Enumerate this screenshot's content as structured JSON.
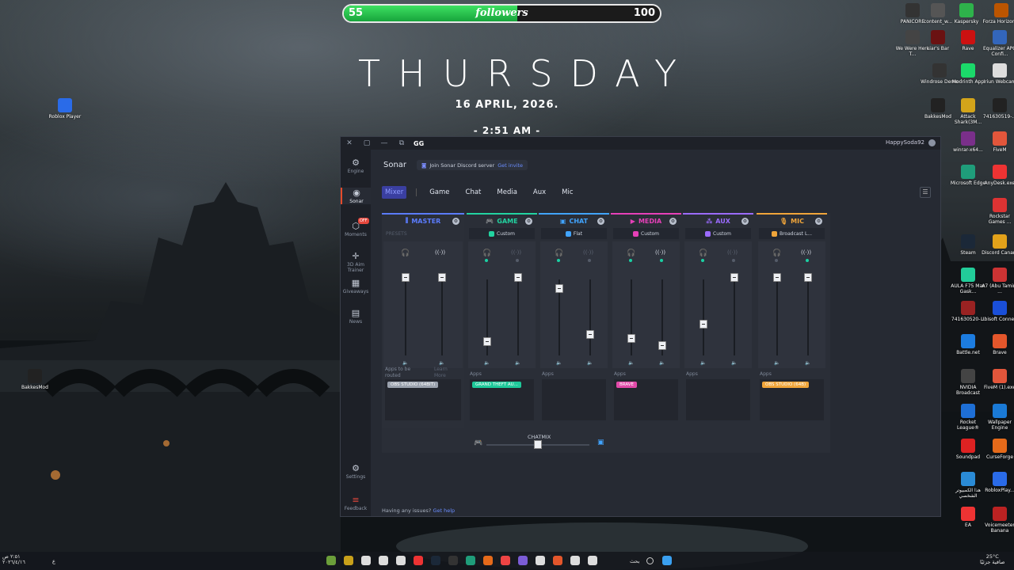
{
  "overlay": {
    "followers_current": "55",
    "followers_label": "followers",
    "followers_goal": "100",
    "followers_progress": 0.55,
    "day": "THURSDAY",
    "date": "16  APRIL, 2026.",
    "time": "- 2:51 AM -"
  },
  "desktop_icons": [
    {
      "label": "Roblox Player",
      "color": "#2a6be8"
    },
    {
      "label": "BakkesMod",
      "color": "#222"
    },
    {
      "label": "PANICORE",
      "color": "#333"
    },
    {
      "label": "content_w...",
      "color": "#555"
    },
    {
      "label": "Kaspersky",
      "color": "#2eb24b"
    },
    {
      "label": "Forza Horizon 5",
      "color": "#b50"
    },
    {
      "label": "We Were Here T...",
      "color": "#444"
    },
    {
      "label": "Liar's Bar",
      "color": "#6a1212"
    },
    {
      "label": "Rave",
      "color": "#c11"
    },
    {
      "label": "Equalizer APO Confi...",
      "color": "#36b"
    },
    {
      "label": "Windrose Demo",
      "color": "#333"
    },
    {
      "label": "Modrinth App",
      "color": "#1bd96a"
    },
    {
      "label": "Iriun Webcam",
      "color": "#ddd"
    },
    {
      "label": "BakkesMod",
      "color": "#222"
    },
    {
      "label": "Attack Shark(3M...",
      "color": "#d3a41a"
    },
    {
      "label": "741630519-...",
      "color": "#222"
    },
    {
      "label": "winrar-x64...",
      "color": "#7a2f8a"
    },
    {
      "label": "FiveM",
      "color": "#e2563b"
    },
    {
      "label": "Microsoft Edge",
      "color": "#1f9d7a"
    },
    {
      "label": "AnyDesk.exe",
      "color": "#e33"
    },
    {
      "label": "Rockstar Games ...",
      "color": "#d33"
    },
    {
      "label": "Steam",
      "color": "#1b2838"
    },
    {
      "label": "Discord Canary",
      "color": "#e3a21a"
    },
    {
      "label": "AULA F75 Max Gask...",
      "color": "#2c9"
    },
    {
      "label": "A7 (Abu Tamim ...",
      "color": "#c33"
    },
    {
      "label": "741630520-...",
      "color": "#922"
    },
    {
      "label": "Ubisoft Connect",
      "color": "#1a4fd8"
    },
    {
      "label": "Battle.net",
      "color": "#1c7ce0"
    },
    {
      "label": "Brave",
      "color": "#e4562b"
    },
    {
      "label": "NVIDIA Broadcast",
      "color": "#444"
    },
    {
      "label": "FiveM (1).exe",
      "color": "#e2563b"
    },
    {
      "label": "Rocket League®",
      "color": "#1e6fd6"
    },
    {
      "label": "Wallpaper Engine",
      "color": "#1a7ad6"
    },
    {
      "label": "Soundpad",
      "color": "#d22"
    },
    {
      "label": "CurseForge",
      "color": "#e56a1a"
    },
    {
      "label": "هذا الكمبيوتر الشخصي",
      "color": "#2a8bd6"
    },
    {
      "label": "RobloxPlay...",
      "color": "#2a6be8"
    },
    {
      "label": "EA",
      "color": "#e33"
    },
    {
      "label": "Voicemeeter Banana",
      "color": "#b22"
    }
  ],
  "titlebar": {
    "logo": "GG",
    "user": "HappySoda92",
    "close": "✕",
    "restore": "▢",
    "minimize": "—",
    "link": "⧉"
  },
  "sidebar": [
    {
      "label": "Engine",
      "glyph": "⚙"
    },
    {
      "label": "Sonar",
      "glyph": "◉"
    },
    {
      "label": "Moments",
      "glyph": "⬡",
      "badge": "OFF"
    },
    {
      "label": "3D Aim Trainer",
      "glyph": "✛"
    },
    {
      "label": "Giveaways",
      "glyph": "▦"
    },
    {
      "label": "News",
      "glyph": "▤"
    },
    {
      "label": "Settings",
      "glyph": "⚙"
    },
    {
      "label": "Feedback",
      "glyph": "≡"
    }
  ],
  "header": {
    "title": "Sonar",
    "discord_text": "Join Sonar Discord server",
    "discord_link": "Get invite"
  },
  "tabs": [
    "Mixer",
    "Game",
    "Chat",
    "Media",
    "Aux",
    "Mic"
  ],
  "channels": [
    {
      "name": "MASTER",
      "preset": "PRESETS",
      "color": "#5b7cff",
      "glyph": "⫼",
      "left_level": 1.0,
      "right_level": 1.0,
      "apps_label": "Apps to be routed",
      "learn": "Learn More",
      "chip": "OBS STUDIO (64BIT)",
      "chip_color": "#9aa1ad"
    },
    {
      "name": "GAME",
      "preset": "Custom",
      "color": "#22d3a0",
      "glyph": "🎮",
      "left_level": 0.1,
      "right_level": 1.0,
      "apps_label": "Apps",
      "chip": "GRAND THEFT AU...",
      "chip_color": "#1ec99a"
    },
    {
      "name": "CHAT",
      "preset": "Flat",
      "color": "#41a4ff",
      "glyph": "▣",
      "left_level": 0.85,
      "right_level": 0.2,
      "apps_label": "Apps",
      "chip": "",
      "chip_color": ""
    },
    {
      "name": "MEDIA",
      "preset": "Custom",
      "color": "#e640b8",
      "glyph": "▶",
      "left_level": 0.15,
      "right_level": 0.05,
      "apps_label": "Apps",
      "chip": "BRAVE",
      "chip_color": "#e24aa9"
    },
    {
      "name": "AUX",
      "preset": "Custom",
      "color": "#9b6bff",
      "glyph": "⁂",
      "left_level": 0.35,
      "right_level": 1.0,
      "apps_label": "Apps",
      "chip": "",
      "chip_color": ""
    },
    {
      "name": "MIC",
      "preset": "Broadcast L...",
      "color": "#f0a53a",
      "glyph": "🎙",
      "left_level": 1.0,
      "right_level": 1.0,
      "apps_label": "Apps",
      "chip": "OBS STUDIO (64B)",
      "chip_color": "#f0a53a"
    }
  ],
  "chatmix": {
    "label": "CHATMIX",
    "balance": 0.5
  },
  "help": {
    "text": "Having any issues?",
    "link": "Get help"
  },
  "taskbar": {
    "left_time": "٢:٥١ ص",
    "left_date": "٢٠٢٦/٤/١٦",
    "lang": "ع",
    "search": "بحث",
    "weather": "25°C",
    "weather_desc": "صافية جزئيًا"
  }
}
